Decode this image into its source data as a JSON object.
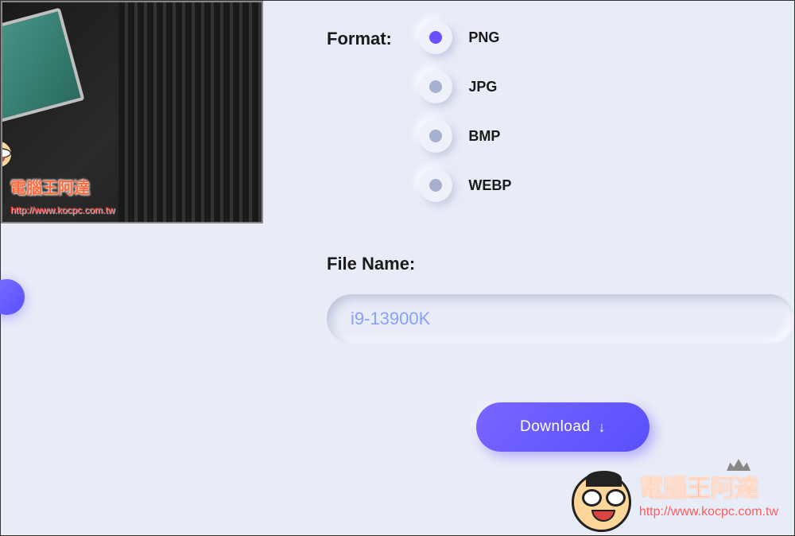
{
  "format": {
    "label": "Format:",
    "options": [
      {
        "value": "PNG",
        "selected": true
      },
      {
        "value": "JPG",
        "selected": false
      },
      {
        "value": "BMP",
        "selected": false
      },
      {
        "value": "WEBP",
        "selected": false
      }
    ]
  },
  "filename": {
    "label": "File Name:",
    "value": "i9-13900K"
  },
  "download": {
    "label": "Download",
    "icon": "↓"
  },
  "watermark": {
    "text": "電腦王阿達",
    "url": "http://www.kocpc.com.tw"
  }
}
